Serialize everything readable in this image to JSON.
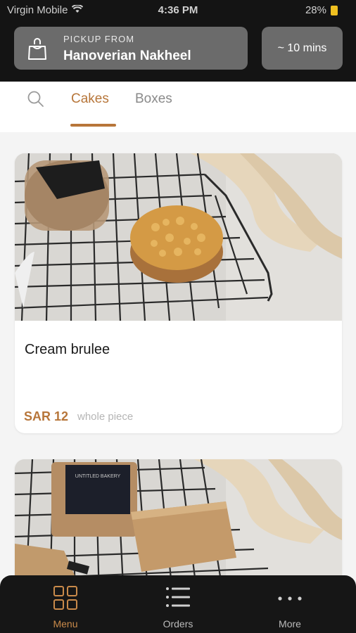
{
  "status_bar": {
    "carrier": "Virgin Mobile",
    "time": "4:36 PM",
    "battery": "28%"
  },
  "pickup": {
    "heading": "PICKUP FROM",
    "location": "Hanoverian Nakheel"
  },
  "eta": "~ 10 mins",
  "tabs": [
    {
      "label": "Cakes",
      "active": true
    },
    {
      "label": "Boxes",
      "active": false
    }
  ],
  "products": [
    {
      "name": "Cream brulee",
      "price": "SAR 12",
      "unit": "whole piece"
    },
    {
      "brand_label": "UNTITLED BAKERY"
    }
  ],
  "bottom_nav": [
    {
      "label": "Menu",
      "icon": "grid-icon",
      "active": true
    },
    {
      "label": "Orders",
      "icon": "list-icon",
      "active": false
    },
    {
      "label": "More",
      "icon": "dots-icon",
      "active": false
    }
  ],
  "colors": {
    "accent": "#b7763a",
    "header_bg": "#141414",
    "pill_bg": "#6b6b6b",
    "nav_bg": "#161616"
  }
}
